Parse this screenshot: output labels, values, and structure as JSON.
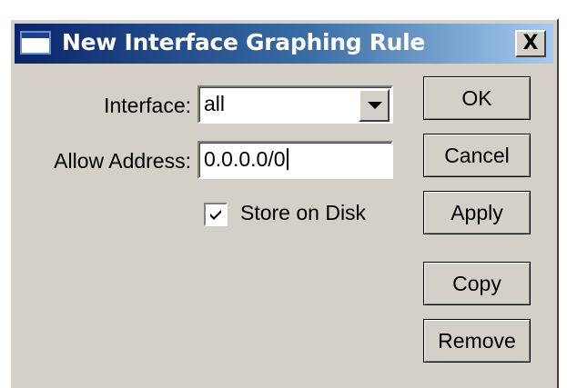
{
  "window": {
    "title": "New Interface Graphing Rule",
    "close_label": "X"
  },
  "form": {
    "interface_label": "Interface:",
    "interface_value": "all",
    "allow_address_label": "Allow Address:",
    "allow_address_value": "0.0.0.0/0",
    "store_on_disk_label": "Store on Disk",
    "store_on_disk_checked": true
  },
  "buttons": {
    "ok": "OK",
    "cancel": "Cancel",
    "apply": "Apply",
    "copy": "Copy",
    "remove": "Remove"
  },
  "colors": {
    "titlebar_start": "#0a246a",
    "titlebar_end": "#a6caf0",
    "face": "#d4d0c8"
  }
}
